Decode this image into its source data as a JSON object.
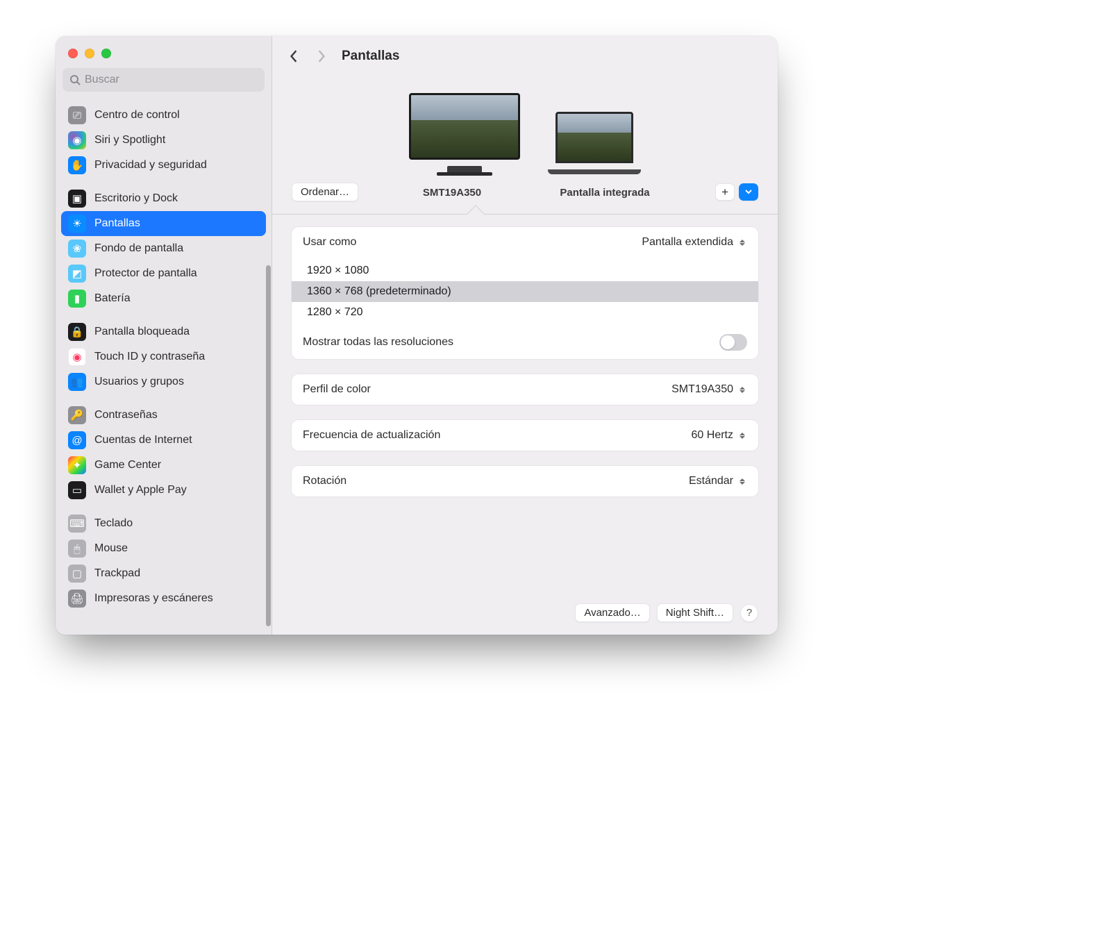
{
  "header": {
    "title": "Pantallas"
  },
  "search": {
    "placeholder": "Buscar"
  },
  "sidebar": {
    "groups": [
      {
        "items": [
          {
            "label": "Centro de control",
            "iconCls": "i-control",
            "glyph": "⎚"
          },
          {
            "label": "Siri y Spotlight",
            "iconCls": "i-siri",
            "glyph": "◉"
          },
          {
            "label": "Privacidad y seguridad",
            "iconCls": "i-priv",
            "glyph": "✋"
          }
        ]
      },
      {
        "items": [
          {
            "label": "Escritorio y Dock",
            "iconCls": "i-desk",
            "glyph": "▣"
          },
          {
            "label": "Pantallas",
            "iconCls": "i-disp",
            "glyph": "☀",
            "selected": true
          },
          {
            "label": "Fondo de pantalla",
            "iconCls": "i-wall",
            "glyph": "❀"
          },
          {
            "label": "Protector de pantalla",
            "iconCls": "i-saver",
            "glyph": "◩"
          },
          {
            "label": "Batería",
            "iconCls": "i-batt",
            "glyph": "▮"
          }
        ]
      },
      {
        "items": [
          {
            "label": "Pantalla bloqueada",
            "iconCls": "i-lock",
            "glyph": "🔒"
          },
          {
            "label": "Touch ID y contraseña",
            "iconCls": "i-touch",
            "glyph": "◉"
          },
          {
            "label": "Usuarios y grupos",
            "iconCls": "i-users",
            "glyph": "👥"
          }
        ]
      },
      {
        "items": [
          {
            "label": "Contraseñas",
            "iconCls": "i-pass",
            "glyph": "🔑"
          },
          {
            "label": "Cuentas de Internet",
            "iconCls": "i-int",
            "glyph": "@"
          },
          {
            "label": "Game Center",
            "iconCls": "i-game",
            "glyph": "✦"
          },
          {
            "label": "Wallet y Apple Pay",
            "iconCls": "i-wallet",
            "glyph": "▭"
          }
        ]
      },
      {
        "items": [
          {
            "label": "Teclado",
            "iconCls": "i-kbd",
            "glyph": "⌨"
          },
          {
            "label": "Mouse",
            "iconCls": "i-mouse",
            "glyph": "🖱"
          },
          {
            "label": "Trackpad",
            "iconCls": "i-track",
            "glyph": "▢"
          },
          {
            "label": "Impresoras y escáneres",
            "iconCls": "i-print",
            "glyph": "🖨"
          }
        ]
      }
    ]
  },
  "displays": {
    "arrange_label": "Ordenar…",
    "items": [
      {
        "label": "SMT19A350",
        "selected": true,
        "kind": "monitor"
      },
      {
        "label": "Pantalla integrada",
        "kind": "laptop"
      }
    ]
  },
  "settings": {
    "useAs": {
      "label": "Usar como",
      "value": "Pantalla extendida"
    },
    "resolutions": [
      {
        "label": "1920 × 1080"
      },
      {
        "label": "1360 × 768 (predeterminado)",
        "selected": true
      },
      {
        "label": "1280 × 720"
      }
    ],
    "showAll": {
      "label": "Mostrar todas las resoluciones",
      "on": false
    },
    "colorProfile": {
      "label": "Perfil de color",
      "value": "SMT19A350"
    },
    "refresh": {
      "label": "Frecuencia de actualización",
      "value": "60 Hertz"
    },
    "rotation": {
      "label": "Rotación",
      "value": "Estándar"
    }
  },
  "footer": {
    "advanced": "Avanzado…",
    "nightShift": "Night Shift…",
    "help": "?"
  }
}
